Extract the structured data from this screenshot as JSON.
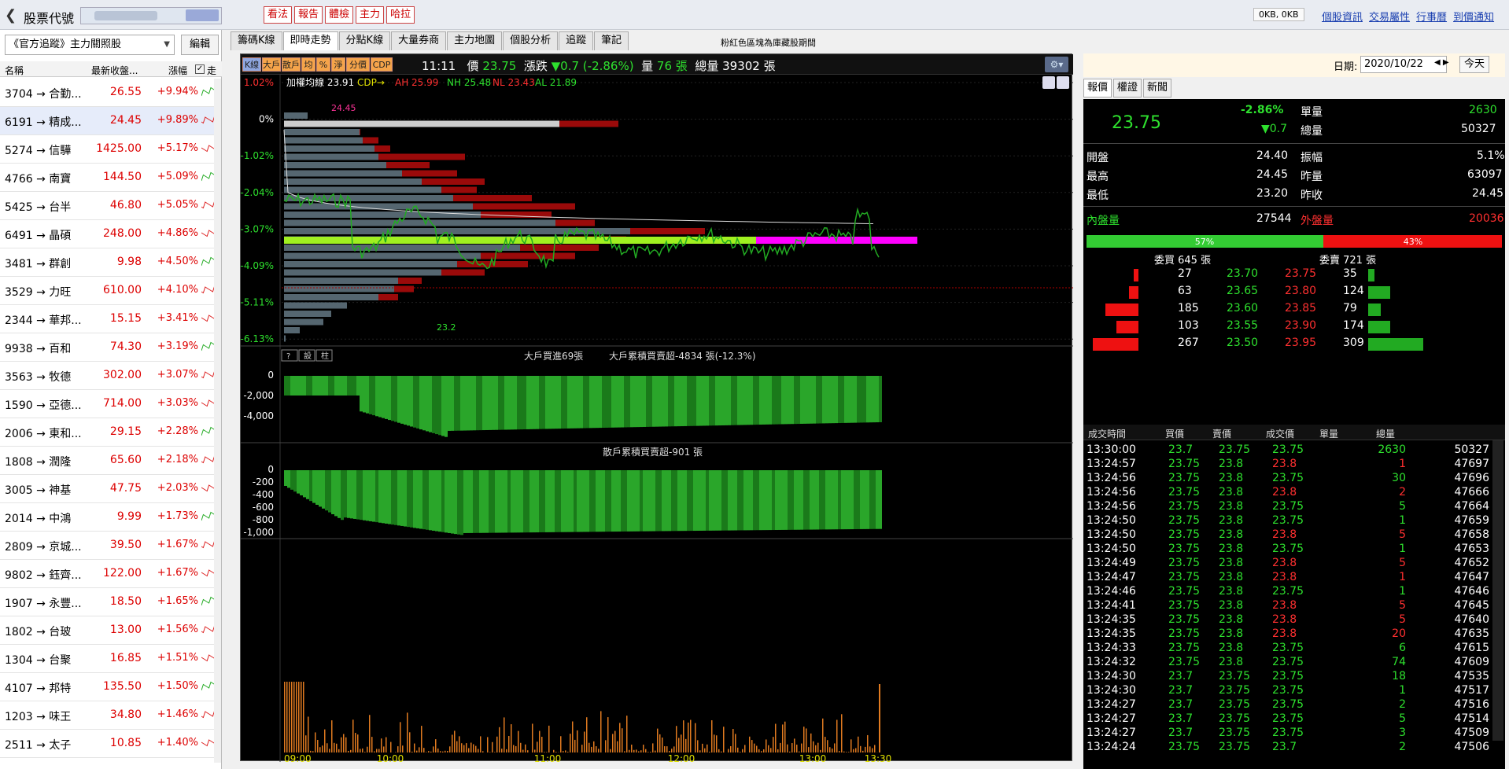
{
  "top": {
    "symbol_label": "股票代號",
    "buttons": [
      "看法",
      "報告",
      "體檢",
      "主力",
      "哈拉"
    ],
    "kb": "0KB, 0KB",
    "links": [
      "個股資訊",
      "交易屬性",
      "行事曆",
      "到價通知"
    ]
  },
  "left": {
    "watchlist": "《官方追蹤》主力關照股",
    "edit": "編輯",
    "headers": [
      "名稱",
      "最新收盤...",
      "漲幅",
      "走"
    ],
    "rows": [
      {
        "name": "3704 → 合勤...",
        "price": "26.55",
        "chg": "+9.94%"
      },
      {
        "name": "6191 → 精成...",
        "price": "24.45",
        "chg": "+9.89%"
      },
      {
        "name": "5274 → 信驊",
        "price": "1425.00",
        "chg": "+5.17%"
      },
      {
        "name": "4766 → 南寶",
        "price": "144.50",
        "chg": "+5.09%"
      },
      {
        "name": "5425 → 台半",
        "price": "46.80",
        "chg": "+5.05%"
      },
      {
        "name": "6491 → 晶碩",
        "price": "248.00",
        "chg": "+4.86%"
      },
      {
        "name": "3481 → 群創",
        "price": "9.98",
        "chg": "+4.50%"
      },
      {
        "name": "3529 → 力旺",
        "price": "610.00",
        "chg": "+4.10%"
      },
      {
        "name": "2344 → 華邦...",
        "price": "15.15",
        "chg": "+3.41%"
      },
      {
        "name": "9938 → 百和",
        "price": "74.30",
        "chg": "+3.19%"
      },
      {
        "name": "3563 → 牧德",
        "price": "302.00",
        "chg": "+3.07%"
      },
      {
        "name": "1590 → 亞德...",
        "price": "714.00",
        "chg": "+3.03%"
      },
      {
        "name": "2006 → 東和...",
        "price": "29.15",
        "chg": "+2.28%"
      },
      {
        "name": "1808 → 潤隆",
        "price": "65.60",
        "chg": "+2.18%"
      },
      {
        "name": "3005 → 神基",
        "price": "47.75",
        "chg": "+2.03%"
      },
      {
        "name": "2014 → 中鴻",
        "price": "9.99",
        "chg": "+1.73%"
      },
      {
        "name": "2809 → 京城...",
        "price": "39.50",
        "chg": "+1.67%"
      },
      {
        "name": "9802 → 鈺齊...",
        "price": "122.00",
        "chg": "+1.67%"
      },
      {
        "name": "1907 → 永豐...",
        "price": "18.50",
        "chg": "+1.65%"
      },
      {
        "name": "1802 → 台玻",
        "price": "13.00",
        "chg": "+1.56%"
      },
      {
        "name": "1304 → 台聚",
        "price": "16.85",
        "chg": "+1.51%"
      },
      {
        "name": "4107 → 邦特",
        "price": "135.50",
        "chg": "+1.50%"
      },
      {
        "name": "1203 → 味王",
        "price": "34.80",
        "chg": "+1.46%"
      },
      {
        "name": "2511 → 太子",
        "price": "10.85",
        "chg": "+1.40%"
      }
    ]
  },
  "center": {
    "tabs": [
      "籌碼K線",
      "即時走勢",
      "分點K線",
      "大量券商",
      "主力地圖",
      "個股分析",
      "追蹤",
      "筆記"
    ],
    "note": "粉紅色區塊為庫藏股期間",
    "chart_buttons": [
      "K線",
      "大戶",
      "散戶",
      "均",
      "%",
      "淨",
      "分價",
      "CDP"
    ],
    "info": {
      "time": "11:11",
      "price_label": "價",
      "price": "23.75",
      "chg_label": "漲跌",
      "chg": "▼0.7 (-2.86%)",
      "vol_label": "量",
      "vol": "76 張",
      "total_label": "總量",
      "total": "39302 張"
    },
    "legend": {
      "avg": "加權均線 23.91",
      "cdp": "CDP→",
      "ah": "AH 25.99",
      "nh": "NH 25.48",
      "nl": "NL 23.43",
      "al": "AL 21.89"
    },
    "pct_ticks": [
      "1.02%",
      "0%",
      "-1.02%",
      "-2.04%",
      "-3.07%",
      "-4.09%",
      "-5.11%",
      "-6.13%"
    ],
    "high_label": "24.45",
    "low_label": "23.2",
    "panel2_title": "大戶買進69張",
    "panel2_sub": "大戶累積買賣超-4834 張(-12.3%)",
    "panel2_ticks": [
      "0",
      "-2,000",
      "-4,000"
    ],
    "panel3_title": "散戶累積買賣超-901 張",
    "panel3_ticks": [
      "0",
      "-200",
      "-400",
      "-600",
      "-800",
      "-1,000"
    ],
    "time_ticks": [
      "09:00",
      "10:00",
      "11:00",
      "12:00",
      "13:00",
      "13:30"
    ],
    "small_btns": [
      "?",
      "設",
      "柱"
    ]
  },
  "right": {
    "date_label": "日期:",
    "date": "2020/10/22",
    "today": "今天",
    "tabs": [
      "報價",
      "權證",
      "新聞"
    ],
    "price": "23.75",
    "pct": "-2.86%",
    "chg": "▼0.7",
    "stats": [
      [
        "單量",
        "2630"
      ],
      [
        "總量",
        "50327"
      ]
    ],
    "open": [
      "開盤",
      "24.40"
    ],
    "amp": [
      "振幅",
      "5.1%"
    ],
    "high": [
      "最高",
      "24.45"
    ],
    "yvol": [
      "昨量",
      "63097"
    ],
    "low": [
      "最低",
      "23.20"
    ],
    "yclose": [
      "昨收",
      "24.45"
    ],
    "inner": [
      "內盤量",
      "27544"
    ],
    "outer": [
      "外盤量",
      "20036"
    ],
    "buy_pct": "57%",
    "sell_pct": "43%",
    "buy_label": "委買 645 張",
    "sell_label": "委賣 721 張",
    "book": [
      [
        "27",
        "23.70",
        "23.75",
        "35"
      ],
      [
        "63",
        "23.65",
        "23.80",
        "124"
      ],
      [
        "185",
        "23.60",
        "23.85",
        "79"
      ],
      [
        "103",
        "23.55",
        "23.90",
        "174"
      ],
      [
        "267",
        "23.50",
        "23.95",
        "309"
      ]
    ],
    "trade_headers": [
      "成交時間",
      "買價",
      "賣價",
      "成交價",
      "單量",
      "總量"
    ],
    "trades": [
      [
        "13:30:00",
        "23.7",
        "23.75",
        "23.75",
        "2630",
        "50327"
      ],
      [
        "13:24:57",
        "23.75",
        "23.8",
        "23.8",
        "1",
        "47697"
      ],
      [
        "13:24:56",
        "23.75",
        "23.8",
        "23.75",
        "30",
        "47696"
      ],
      [
        "13:24:56",
        "23.75",
        "23.8",
        "23.8",
        "2",
        "47666"
      ],
      [
        "13:24:56",
        "23.75",
        "23.8",
        "23.75",
        "5",
        "47664"
      ],
      [
        "13:24:50",
        "23.75",
        "23.8",
        "23.75",
        "1",
        "47659"
      ],
      [
        "13:24:50",
        "23.75",
        "23.8",
        "23.8",
        "5",
        "47658"
      ],
      [
        "13:24:50",
        "23.75",
        "23.8",
        "23.75",
        "1",
        "47653"
      ],
      [
        "13:24:49",
        "23.75",
        "23.8",
        "23.8",
        "5",
        "47652"
      ],
      [
        "13:24:47",
        "23.75",
        "23.8",
        "23.8",
        "1",
        "47647"
      ],
      [
        "13:24:46",
        "23.75",
        "23.8",
        "23.75",
        "1",
        "47646"
      ],
      [
        "13:24:41",
        "23.75",
        "23.8",
        "23.8",
        "5",
        "47645"
      ],
      [
        "13:24:35",
        "23.75",
        "23.8",
        "23.8",
        "5",
        "47640"
      ],
      [
        "13:24:35",
        "23.75",
        "23.8",
        "23.8",
        "20",
        "47635"
      ],
      [
        "13:24:33",
        "23.75",
        "23.8",
        "23.75",
        "6",
        "47615"
      ],
      [
        "13:24:32",
        "23.75",
        "23.8",
        "23.75",
        "74",
        "47609"
      ],
      [
        "13:24:30",
        "23.7",
        "23.75",
        "23.75",
        "18",
        "47535"
      ],
      [
        "13:24:30",
        "23.7",
        "23.75",
        "23.75",
        "1",
        "47517"
      ],
      [
        "13:24:27",
        "23.7",
        "23.75",
        "23.75",
        "2",
        "47516"
      ],
      [
        "13:24:27",
        "23.7",
        "23.75",
        "23.75",
        "5",
        "47514"
      ],
      [
        "13:24:27",
        "23.7",
        "23.75",
        "23.75",
        "3",
        "47509"
      ],
      [
        "13:24:24",
        "23.75",
        "23.75",
        "23.7",
        "2",
        "47506"
      ]
    ]
  }
}
